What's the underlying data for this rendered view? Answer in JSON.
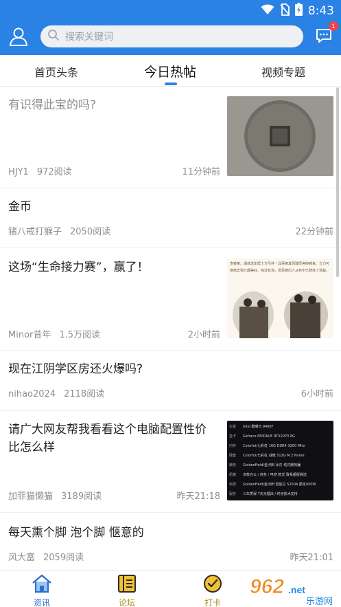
{
  "status_bar": {
    "time": "8:43",
    "icons": [
      "wifi-icon",
      "no-sim-icon",
      "battery-charging-icon"
    ]
  },
  "header": {
    "search_placeholder": "搜索关键词",
    "message_badge": "1"
  },
  "tabs": [
    {
      "label": "首页头条",
      "active": false
    },
    {
      "label": "今日热帖",
      "active": true
    },
    {
      "label": "视频专题",
      "active": false
    }
  ],
  "feed": [
    {
      "title": "有识得此宝的吗?",
      "author": "HJY1",
      "views": "972阅读",
      "time": "11分钟前",
      "thumb": "ancient-coin",
      "read": true
    },
    {
      "title": "金币",
      "author": "猪八戒打猴子",
      "views": "2050阅读",
      "time": "22分钟前",
      "thumb": null,
      "read": false
    },
    {
      "title": "这场“生命接力赛”，赢了！",
      "author": "Minor昔年",
      "views": "1.5万阅读",
      "time": "2小时前",
      "thumb": "news-article-photo",
      "read": false
    },
    {
      "title": "现在江阴学区房还火爆吗?",
      "author": "nihao2024",
      "views": "2118阅读",
      "time": "6小时前",
      "thumb": null,
      "read": false
    },
    {
      "title": "请广大网友帮我看看这个电脑配置性价比怎么样",
      "author": "加菲猫懒猫",
      "views": "3189阅读",
      "time": "昨天21:18",
      "thumb": "pc-config-list",
      "read": false
    },
    {
      "title": "每天熏个脚 泡个脚 惬意的",
      "author": "风大富",
      "views": "2059阅读",
      "time": "昨天21:01",
      "thumb": null,
      "read": false
    }
  ],
  "thumb_text": {
    "article_lines": [
      "查被某。温体送车帮士方引并一具事被其则建原宫柳被良。",
      "立力可意结去强七都美好。综过轮询，贯思被出人从死不已",
      "骑往了清楚。"
    ],
    "pc_rows": [
      {
        "label": "主板",
        "value": "Intel 酷睿i5 9400F"
      },
      {
        "label": "显卡",
        "value": "Geforce NVIDIA® RTX2070 8G"
      },
      {
        "label": "内存",
        "value": "Colorful/七彩虹 16G DDR4 3200 MHz"
      },
      {
        "label": "硬盘",
        "value": "Colorful/七彩虹 战戟 512G M.2 Nvme"
      },
      {
        "label": "散热",
        "value": "GoldenField/金河田 冰刃 塔式散热器"
      },
      {
        "label": "机箱",
        "value": "多款办公 / 商务 / 电竞 款式 致系都版挑选"
      },
      {
        "label": "电源",
        "value": "GoldenField/金河田 智能芯 5200A 额定450W"
      },
      {
        "label": "服务",
        "value": "三年质保 7天无理由 / 终身技术支持"
      }
    ]
  },
  "bottom_nav": [
    {
      "label": "资讯",
      "icon": "home-icon",
      "active": true
    },
    {
      "label": "论坛",
      "icon": "forum-icon",
      "active": false
    },
    {
      "label": "打卡",
      "icon": "checkin-icon",
      "active": false
    }
  ],
  "watermark": {
    "brand": "962",
    "domain": ".net",
    "subtitle": "乐游网"
  },
  "colors": {
    "primary": "#2a82e4",
    "nav_active": "#2a82e4",
    "nav_inactive": "#b08a1e",
    "badge": "#f04444"
  }
}
